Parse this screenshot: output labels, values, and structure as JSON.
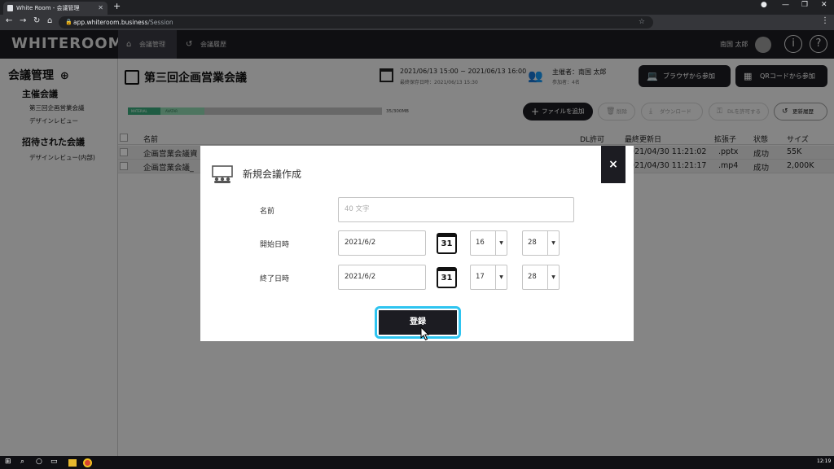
{
  "browser": {
    "tab_title": "White Room - 会議管理",
    "url_host": "app.whiteroom.business",
    "url_path": "/Session"
  },
  "header": {
    "logo": "WHITEROOM",
    "nav": [
      "会議管理",
      "会議履歴"
    ],
    "user_name": "南国 太郎",
    "info_icon": "i",
    "help_icon": "?"
  },
  "sidebar": {
    "title": "会議管理",
    "hosted_heading": "主催会議",
    "hosted_items": [
      "第三回企画営業会議",
      "デザインレビュー"
    ],
    "invited_heading": "招待された会議",
    "invited_items": [
      "デザインレビュー(内部)"
    ]
  },
  "meeting": {
    "title": "第三回企画営業会議",
    "datetime": "2021/06/13 15:00 ~ 2021/06/13 16:00",
    "last_saved": "最終保存日時：2021/06/13 15:30",
    "host": "主催者：南国 太郎",
    "participants": "参加者：4名",
    "browser_join": "ブラウザから参加",
    "qr_join": "QRコードから参加"
  },
  "storage": {
    "material_label": "MATERIAL",
    "avatar_label": "AVATAR",
    "usage_text": "35/300MB",
    "material_fraction": 0.13,
    "avatar_fraction": 0.17
  },
  "toolbar": {
    "add_file": "ファイルを追加",
    "delete": "削除",
    "download": "ダウンロード",
    "allow_dl": "DLを許可する",
    "history": "更新履歴"
  },
  "table": {
    "headers": [
      "名前",
      "DL許可",
      "最終更新日",
      "拡張子",
      "状態",
      "サイズ"
    ],
    "rows": [
      {
        "name": "企画営業会議資",
        "date": "2021/04/30 11:21:02",
        "ext": ".pptx",
        "status": "成功",
        "size": "55K"
      },
      {
        "name": "企画営業会議_",
        "date": "2021/04/30 11:21:17",
        "ext": ".mp4",
        "status": "成功",
        "size": "2,000K"
      }
    ]
  },
  "modal": {
    "title": "新規会議作成",
    "close": "×",
    "name_label": "名前",
    "name_placeholder": "40 文字",
    "start_label": "開始日時",
    "start_date": "2021/6/2",
    "start_hour": "16",
    "start_minute": "28",
    "end_label": "終了日時",
    "end_date": "2021/6/2",
    "end_hour": "17",
    "end_minute": "28",
    "calendar_day": "31",
    "submit": "登録"
  },
  "taskbar": {
    "time": "12:19"
  },
  "colors": {
    "dark": "#1c1c22",
    "accent_ring": "#2ec4f0",
    "material": "#3aa87a",
    "avatar": "#8fd6b0"
  }
}
